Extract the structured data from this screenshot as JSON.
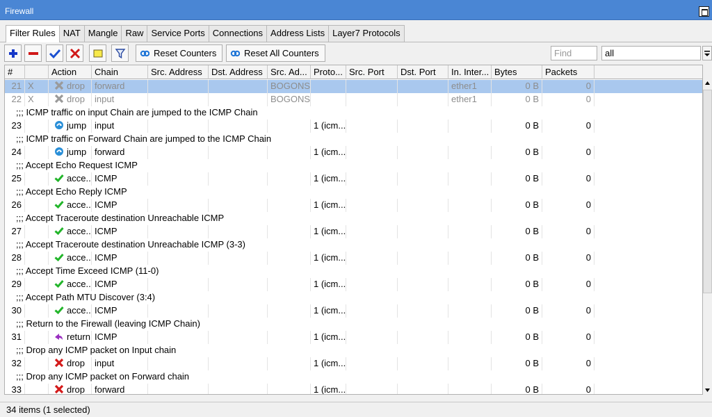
{
  "window": {
    "title": "Firewall"
  },
  "tabs": [
    "Filter Rules",
    "NAT",
    "Mangle",
    "Raw",
    "Service Ports",
    "Connections",
    "Address Lists",
    "Layer7 Protocols"
  ],
  "active_tab": 0,
  "toolbar": {
    "reset_counters": "Reset Counters",
    "reset_all_counters": "Reset All Counters",
    "find_placeholder": "Find",
    "filter_value": "all"
  },
  "columns": [
    "#",
    "",
    "Action",
    "Chain",
    "Src. Address",
    "Dst. Address",
    "Src. Ad...",
    "Proto...",
    "Src. Port",
    "Dst. Port",
    "In. Inter...",
    "Bytes",
    "Packets"
  ],
  "rows": [
    {
      "type": "rule",
      "num": "21",
      "flag": "X",
      "action": "drop",
      "icon": "drop-disabled-icon",
      "chain": "forward",
      "src_list": "BOGONS",
      "proto": "",
      "in_iface": "ether1",
      "bytes": "0 B",
      "packets": "0",
      "selected": true,
      "disabled": true
    },
    {
      "type": "rule",
      "num": "22",
      "flag": "X",
      "action": "drop",
      "icon": "drop-disabled-icon",
      "chain": "input",
      "src_list": "BOGONS",
      "proto": "",
      "in_iface": "ether1",
      "bytes": "0 B",
      "packets": "0",
      "selected": false,
      "disabled": true
    },
    {
      "type": "comment",
      "text": ";;; ICMP traffic on input Chain are jumped to the ICMP Chain"
    },
    {
      "type": "rule",
      "num": "23",
      "flag": "",
      "action": "jump",
      "icon": "jump-icon",
      "chain": "input",
      "src_list": "",
      "proto": "1 (icm...",
      "in_iface": "",
      "bytes": "0 B",
      "packets": "0"
    },
    {
      "type": "comment",
      "text": ";;; ICMP traffic on Forward Chain are jumped to the ICMP Chain"
    },
    {
      "type": "rule",
      "num": "24",
      "flag": "",
      "action": "jump",
      "icon": "jump-icon",
      "chain": "forward",
      "src_list": "",
      "proto": "1 (icm...",
      "in_iface": "",
      "bytes": "0 B",
      "packets": "0"
    },
    {
      "type": "comment",
      "text": ";;; Accept Echo Request ICMP"
    },
    {
      "type": "rule",
      "num": "25",
      "flag": "",
      "action": "acce...",
      "icon": "accept-icon",
      "chain": "ICMP",
      "src_list": "",
      "proto": "1 (icm...",
      "in_iface": "",
      "bytes": "0 B",
      "packets": "0"
    },
    {
      "type": "comment",
      "text": ";;; Accept Echo Reply ICMP"
    },
    {
      "type": "rule",
      "num": "26",
      "flag": "",
      "action": "acce...",
      "icon": "accept-icon",
      "chain": "ICMP",
      "src_list": "",
      "proto": "1 (icm...",
      "in_iface": "",
      "bytes": "0 B",
      "packets": "0"
    },
    {
      "type": "comment",
      "text": ";;; Accept Traceroute destination Unreachable ICMP"
    },
    {
      "type": "rule",
      "num": "27",
      "flag": "",
      "action": "acce...",
      "icon": "accept-icon",
      "chain": "ICMP",
      "src_list": "",
      "proto": "1 (icm...",
      "in_iface": "",
      "bytes": "0 B",
      "packets": "0"
    },
    {
      "type": "comment",
      "text": ";;; Accept Traceroute destination Unreachable ICMP (3-3)"
    },
    {
      "type": "rule",
      "num": "28",
      "flag": "",
      "action": "acce...",
      "icon": "accept-icon",
      "chain": "ICMP",
      "src_list": "",
      "proto": "1 (icm...",
      "in_iface": "",
      "bytes": "0 B",
      "packets": "0"
    },
    {
      "type": "comment",
      "text": ";;; Accept Time Exceed ICMP (11-0)"
    },
    {
      "type": "rule",
      "num": "29",
      "flag": "",
      "action": "acce...",
      "icon": "accept-icon",
      "chain": "ICMP",
      "src_list": "",
      "proto": "1 (icm...",
      "in_iface": "",
      "bytes": "0 B",
      "packets": "0"
    },
    {
      "type": "comment",
      "text": ";;; Accept Path MTU Discover (3:4)"
    },
    {
      "type": "rule",
      "num": "30",
      "flag": "",
      "action": "acce...",
      "icon": "accept-icon",
      "chain": "ICMP",
      "src_list": "",
      "proto": "1 (icm...",
      "in_iface": "",
      "bytes": "0 B",
      "packets": "0"
    },
    {
      "type": "comment",
      "text": ";;; Return to the Firewall (leaving ICMP Chain)"
    },
    {
      "type": "rule",
      "num": "31",
      "flag": "",
      "action": "return",
      "icon": "return-icon",
      "chain": "ICMP",
      "src_list": "",
      "proto": "1 (icm...",
      "in_iface": "",
      "bytes": "0 B",
      "packets": "0"
    },
    {
      "type": "comment",
      "text": ";;; Drop any ICMP packet on Input chain"
    },
    {
      "type": "rule",
      "num": "32",
      "flag": "",
      "action": "drop",
      "icon": "drop-icon",
      "chain": "input",
      "src_list": "",
      "proto": "1 (icm...",
      "in_iface": "",
      "bytes": "0 B",
      "packets": "0"
    },
    {
      "type": "comment",
      "text": ";;; Drop any ICMP packet on Forward chain"
    },
    {
      "type": "rule",
      "num": "33",
      "flag": "",
      "action": "drop",
      "icon": "drop-icon",
      "chain": "forward",
      "src_list": "",
      "proto": "1 (icm...",
      "in_iface": "",
      "bytes": "0 B",
      "packets": "0"
    }
  ],
  "status": "34 items (1 selected)"
}
